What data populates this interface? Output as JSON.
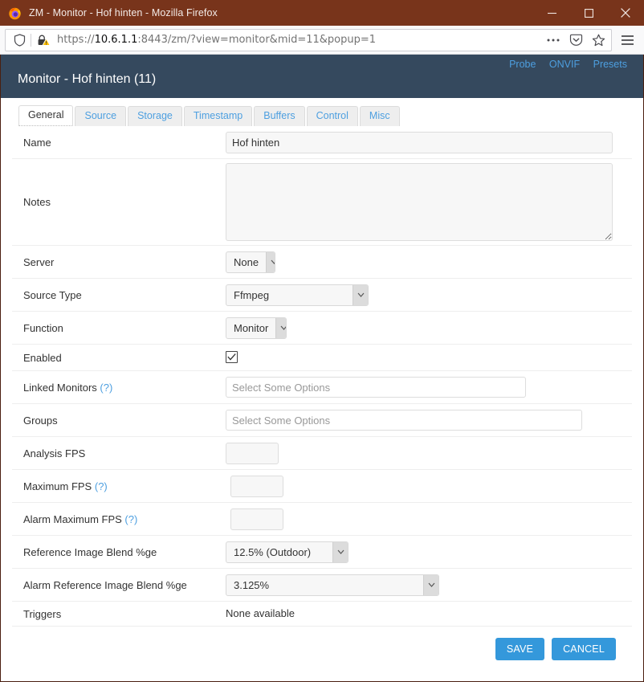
{
  "window": {
    "title": "ZM - Monitor - Hof hinten - Mozilla Firefox",
    "minimize_label": "Minimize",
    "maximize_label": "Maximize",
    "close_label": "Close"
  },
  "browser": {
    "url_scheme": "https://",
    "url_host": "10.6.1.1",
    "url_rest": ":8443/zm/?view=monitor&mid=11&popup=1",
    "url_full": "https://10.6.1.1:8443/zm/?view=monitor&mid=11&popup=1",
    "shield_icon": "shield-icon",
    "lock_warning_icon": "lock-warning-icon",
    "page_actions_icon": "ellipsis-icon",
    "pocket_icon": "pocket-icon",
    "bookmark_icon": "star-icon",
    "menu_icon": "hamburger-menu-icon"
  },
  "header": {
    "title": "Monitor - Hof hinten (11)",
    "links": [
      {
        "label": "Probe"
      },
      {
        "label": "ONVIF"
      },
      {
        "label": "Presets"
      }
    ],
    "background": "#35495e",
    "link_color": "#4d9fe0"
  },
  "tabs": [
    {
      "label": "General",
      "active": true
    },
    {
      "label": "Source",
      "active": false
    },
    {
      "label": "Storage",
      "active": false
    },
    {
      "label": "Timestamp",
      "active": false
    },
    {
      "label": "Buffers",
      "active": false
    },
    {
      "label": "Control",
      "active": false
    },
    {
      "label": "Misc",
      "active": false
    }
  ],
  "form": {
    "name": {
      "label": "Name",
      "value": "Hof hinten"
    },
    "notes": {
      "label": "Notes",
      "value": ""
    },
    "server": {
      "label": "Server",
      "value": "None"
    },
    "source_type": {
      "label": "Source Type",
      "value": "Ffmpeg"
    },
    "function": {
      "label": "Function",
      "value": "Monitor"
    },
    "enabled": {
      "label": "Enabled",
      "checked": true
    },
    "linked_monitors": {
      "label": "Linked Monitors",
      "help": "(?)",
      "placeholder": "Select Some Options",
      "value": ""
    },
    "groups": {
      "label": "Groups",
      "placeholder": "Select Some Options",
      "value": ""
    },
    "analysis_fps": {
      "label": "Analysis FPS",
      "value": ""
    },
    "maximum_fps": {
      "label": "Maximum FPS",
      "help": "(?)",
      "value": ""
    },
    "alarm_maximum_fps": {
      "label": "Alarm Maximum FPS",
      "help": "(?)",
      "value": ""
    },
    "reference_image_blend": {
      "label": "Reference Image Blend %ge",
      "value": "12.5% (Outdoor)"
    },
    "alarm_reference_image_blend": {
      "label": "Alarm Reference Image Blend %ge",
      "value": "3.125%"
    },
    "triggers": {
      "label": "Triggers",
      "value": "None available"
    }
  },
  "actions": {
    "save_label": "SAVE",
    "cancel_label": "CANCEL",
    "button_color": "#3498db"
  }
}
